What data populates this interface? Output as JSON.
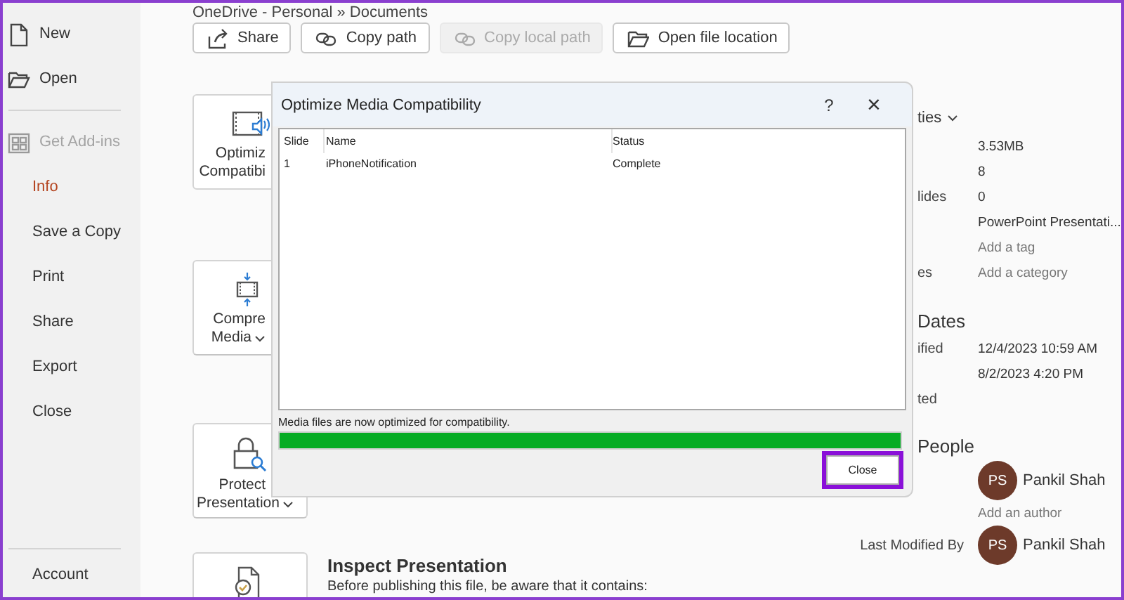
{
  "sidebar": {
    "items": [
      {
        "kind": "item",
        "label": "New",
        "selected": false,
        "disabled": false
      },
      {
        "kind": "item",
        "label": "Open",
        "selected": false,
        "disabled": false
      },
      {
        "kind": "divider"
      },
      {
        "kind": "item",
        "label": "Get Add-ins",
        "selected": false,
        "disabled": true
      },
      {
        "kind": "item",
        "label": "Info",
        "selected": true,
        "disabled": false
      },
      {
        "kind": "item",
        "label": "Save a Copy",
        "selected": false,
        "disabled": false
      },
      {
        "kind": "item",
        "label": "Print",
        "selected": false,
        "disabled": false
      },
      {
        "kind": "item",
        "label": "Share",
        "selected": false,
        "disabled": false
      },
      {
        "kind": "item",
        "label": "Export",
        "selected": false,
        "disabled": false
      },
      {
        "kind": "item",
        "label": "Close",
        "selected": false,
        "disabled": false
      },
      {
        "kind": "divider"
      },
      {
        "kind": "item",
        "label": "Account",
        "selected": false,
        "disabled": false
      }
    ]
  },
  "breadcrumb": "OneDrive - Personal » Documents",
  "toolbar": [
    {
      "label": "Share",
      "disabled": false
    },
    {
      "label": "Copy path",
      "disabled": false
    },
    {
      "label": "Copy local path",
      "disabled": true
    },
    {
      "label": "Open file location",
      "disabled": false
    }
  ],
  "cards": [
    {
      "lines": [
        "Optimiz",
        "Compatibi"
      ],
      "dropdown": false
    },
    {
      "lines": [
        "Compre",
        "Media"
      ],
      "dropdown": true
    },
    {
      "lines": [
        "Protect",
        "Presentation"
      ],
      "dropdown": true
    },
    {
      "title": "Inspect Presentation",
      "text": "Before publishing this file, be aware that it contains:"
    }
  ],
  "properties": {
    "heading": "ties",
    "rows": [
      {
        "kind": "value",
        "value": "3.53MB"
      },
      {
        "kind": "value",
        "value": "8"
      },
      {
        "kind": "value",
        "label": "lides",
        "value": "0"
      },
      {
        "kind": "value",
        "value": "PowerPoint Presentati..."
      },
      {
        "kind": "link",
        "value": "Add a tag"
      },
      {
        "kind": "link",
        "label": "es",
        "value": "Add a category"
      }
    ]
  },
  "dates": {
    "heading": "Dates",
    "rows": [
      {
        "kind": "value",
        "label": "ified",
        "value": "12/4/2023 10:59 AM"
      },
      {
        "kind": "value",
        "value": "8/2/2023 4:20 PM"
      },
      {
        "kind": "value",
        "label": "ted"
      }
    ]
  },
  "people": {
    "heading": "People",
    "rows": [
      {
        "kind": "person",
        "initials": "PS",
        "name": "Pankil Shah"
      },
      {
        "kind": "link",
        "value": "Add an author"
      },
      {
        "kind": "person",
        "label": "Last Modified By",
        "initials": "PS",
        "name": "Pankil Shah"
      }
    ]
  },
  "dialog": {
    "title": "Optimize Media Compatibility",
    "help": "?",
    "close": "×",
    "columns": [
      "Slide",
      "Name",
      "Status"
    ],
    "rows": [
      [
        "1",
        "iPhoneNotification",
        "Complete"
      ]
    ],
    "message": "Media files are now optimized for compatibility.",
    "progress": {
      "level": 1
    },
    "button": {
      "label": "Close",
      "highlighted": true
    }
  }
}
